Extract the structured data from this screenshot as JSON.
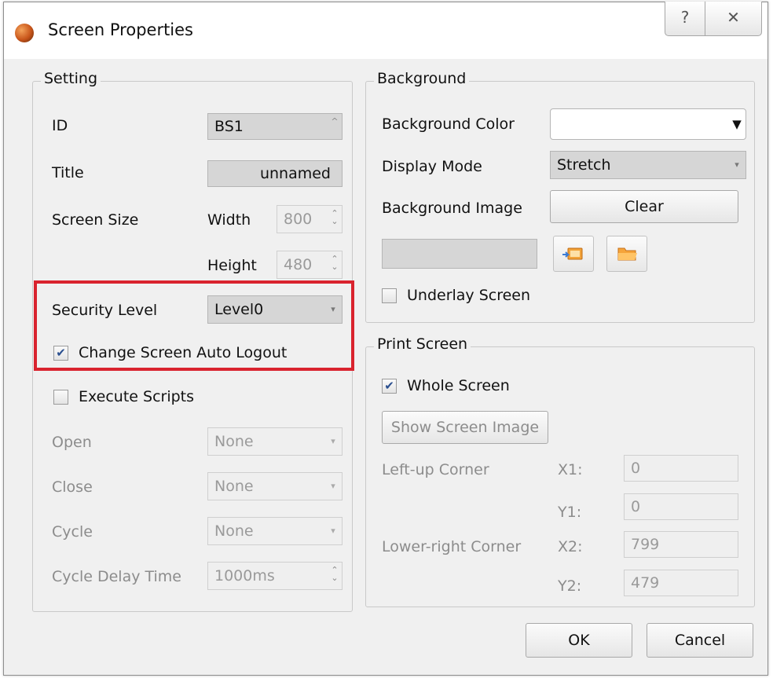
{
  "window": {
    "title": "Screen Properties",
    "help_label": "?",
    "close_label": "✕"
  },
  "setting": {
    "legend": "Setting",
    "id_label": "ID",
    "id_value": "BS1",
    "title_label": "Title",
    "title_value": "unnamed",
    "screen_size_label": "Screen Size",
    "width_label": "Width",
    "width_value": "800",
    "height_label": "Height",
    "height_value": "480",
    "security_level_label": "Security Level",
    "security_level_value": "Level0",
    "auto_logout_label": "Change Screen Auto Logout",
    "auto_logout_checked": true,
    "execute_scripts_label": "Execute Scripts",
    "execute_scripts_checked": false,
    "open_label": "Open",
    "open_value": "None",
    "close_label": "Close",
    "close_value": "None",
    "cycle_label": "Cycle",
    "cycle_value": "None",
    "cycle_delay_label": "Cycle Delay Time",
    "cycle_delay_value": "1000ms"
  },
  "background": {
    "legend": "Background",
    "color_label": "Background Color",
    "display_mode_label": "Display Mode",
    "display_mode_value": "Stretch",
    "image_label": "Background Image",
    "clear_label": "Clear",
    "underlay_label": "Underlay Screen",
    "underlay_checked": false
  },
  "print_screen": {
    "legend": "Print Screen",
    "whole_screen_label": "Whole Screen",
    "whole_screen_checked": true,
    "show_image_label": "Show Screen Image",
    "left_up_label": "Left-up Corner",
    "x1_label": "X1:",
    "x1_value": "0",
    "y1_label": "Y1:",
    "y1_value": "0",
    "lower_right_label": "Lower-right Corner",
    "x2_label": "X2:",
    "x2_value": "799",
    "y2_label": "Y2:",
    "y2_value": "479"
  },
  "footer": {
    "ok_label": "OK",
    "cancel_label": "Cancel"
  },
  "colors": {
    "highlight": "#d9232e",
    "dialog_bg": "#f0f0f0",
    "check_mark": "#2a4f8f"
  }
}
